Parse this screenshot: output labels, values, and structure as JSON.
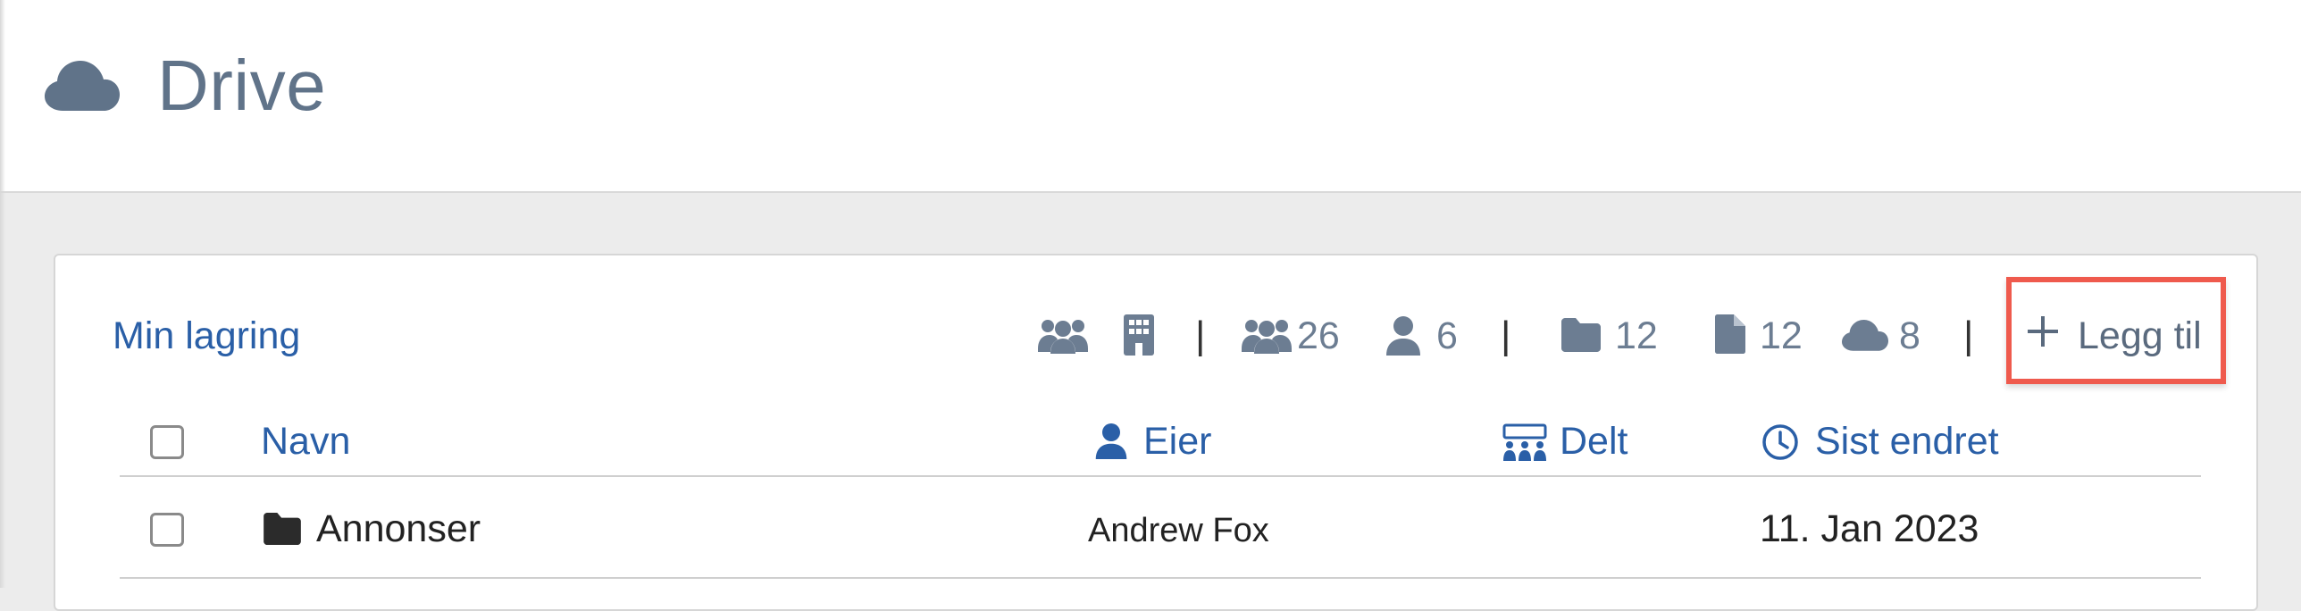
{
  "app": {
    "title": "Drive",
    "icon": "cloud-icon"
  },
  "storage": {
    "title": "Min lagring"
  },
  "filters": {
    "group_icon": "users-icon",
    "org_icon": "building-icon",
    "shared_users_count": "26",
    "single_user_count": "6",
    "folder_count": "12",
    "file_count": "12",
    "cloud_count": "8"
  },
  "toolbar": {
    "add_label": "Legg til"
  },
  "table": {
    "columns": {
      "name": "Navn",
      "owner": "Eier",
      "shared": "Delt",
      "modified": "Sist endret"
    },
    "rows": [
      {
        "name": "Annonser",
        "owner": "Andrew Fox",
        "modified": "11. Jan 2023"
      }
    ]
  },
  "colors": {
    "accent": "#2a5fa7",
    "muted": "#6c7d92",
    "highlight": "#ef5a4d"
  }
}
